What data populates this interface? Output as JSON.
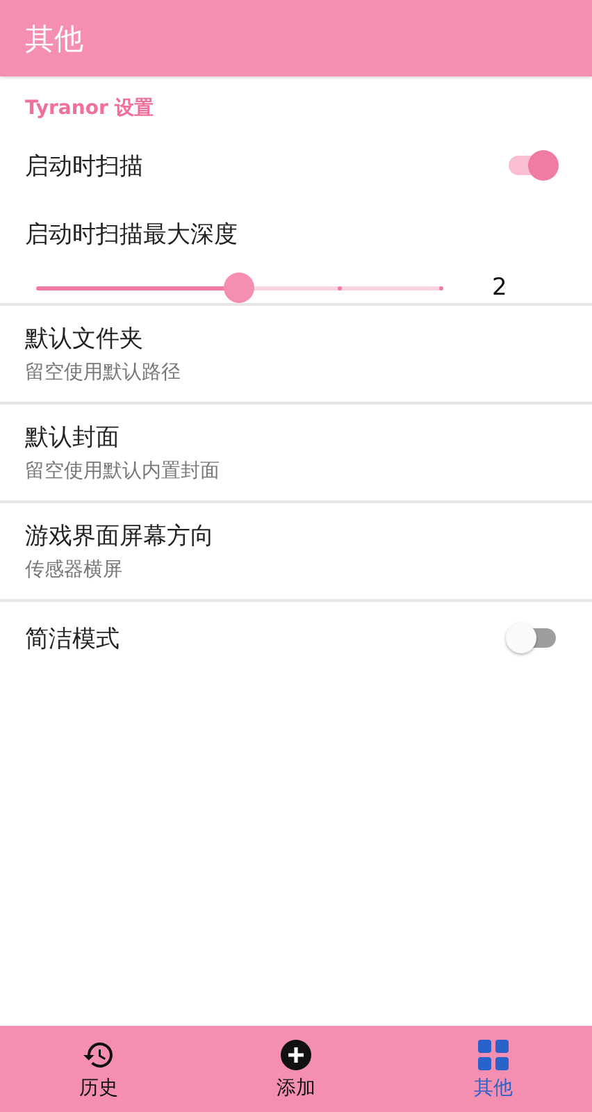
{
  "app_bar": {
    "title": "其他"
  },
  "section": {
    "title": "Tyranor 设置"
  },
  "settings": [
    {
      "kind": "switch",
      "title": "启动时扫描",
      "on": true
    },
    {
      "kind": "slider",
      "title": "启动时扫描最大深度",
      "level": 0.5,
      "reading": "2"
    },
    {
      "kind": "text",
      "title": "默认文件夹",
      "summary": "留空使用默认路径"
    },
    {
      "kind": "text",
      "title": "默认封面",
      "summary": "留空使用默认内置封面"
    },
    {
      "kind": "text",
      "title": "游戏界面屏幕方向",
      "summary": "传感器横屏"
    },
    {
      "kind": "switch",
      "title": "简洁模式",
      "on": false
    }
  ],
  "bottom_nav": [
    {
      "kind": "history",
      "label": "历史",
      "selected": false
    },
    {
      "kind": "add",
      "label": "添加",
      "selected": false
    },
    {
      "kind": "more",
      "label": "其他",
      "selected": true
    }
  ]
}
